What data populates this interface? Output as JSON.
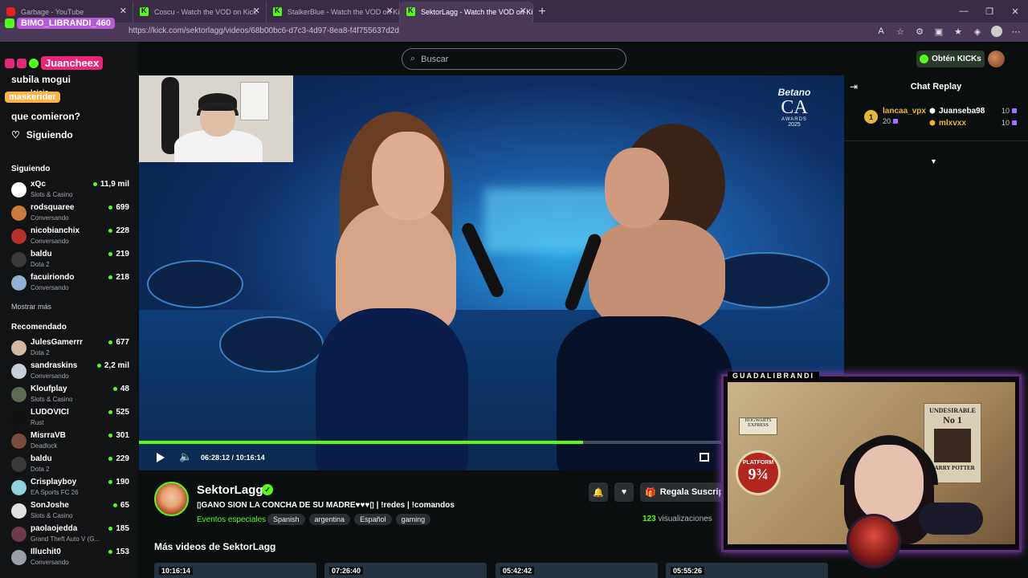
{
  "browser": {
    "tabs": [
      {
        "title": "Garbage - YouTube",
        "icon": "youtube-icon",
        "active": false
      },
      {
        "title": "Coscu - Watch the VOD on Kick",
        "icon": "kick-icon",
        "active": false
      },
      {
        "title": "StalkerBlue - Watch the VOD on Kick",
        "icon": "kick-icon",
        "active": false
      },
      {
        "title": "SektorLagg - Watch the VOD on Kick",
        "icon": "kick-icon",
        "active": true
      }
    ],
    "url": "https://kick.com/sektorlagg/videos/68b00bc6-d7c3-4d97-8ea8-f4f755637d2d"
  },
  "overlay_chat": {
    "user1": "BIMO_LIBRANDI_460",
    "user2": "Juancheex",
    "msg1": "subila mogui",
    "msg2": "lejeje",
    "user3": "maskerider",
    "msg3": "que comieron?"
  },
  "sidebar": {
    "follow_label": "Siguiendo",
    "following_title": "Siguiendo",
    "following": [
      {
        "name": "xQc",
        "category": "Slots & Casino",
        "viewers": "11,9 mil",
        "color": "#ffffff"
      },
      {
        "name": "rodsquaree",
        "category": "Conversando",
        "viewers": "699",
        "color": "#c97b3c"
      },
      {
        "name": "nicobianchix",
        "category": "Conversando",
        "viewers": "228",
        "color": "#b5322a"
      },
      {
        "name": "baldu",
        "category": "Dota 2",
        "viewers": "219",
        "color": "#3a3a3a"
      },
      {
        "name": "facuiriondo",
        "category": "Conversando",
        "viewers": "218",
        "color": "#8fb2d6"
      }
    ],
    "show_more": "Mostrar más",
    "recommended_title": "Recomendado",
    "recommended": [
      {
        "name": "JulesGamerrr",
        "category": "Dota 2",
        "viewers": "677",
        "color": "#d6b7a0"
      },
      {
        "name": "sandraskins",
        "category": "Conversando",
        "viewers": "2,2 mil",
        "color": "#c8cfd6"
      },
      {
        "name": "Kloufplay",
        "category": "Slots & Casino",
        "viewers": "48",
        "color": "#5d6a54"
      },
      {
        "name": "LUDOVICI",
        "category": "Rust",
        "viewers": "525",
        "color": "#101010"
      },
      {
        "name": "MisrraVB",
        "category": "Deadlock",
        "viewers": "301",
        "color": "#7a4b3a"
      },
      {
        "name": "baldu",
        "category": "Dota 2",
        "viewers": "229",
        "color": "#3a3a3a"
      },
      {
        "name": "Crisplayboy",
        "category": "EA Sports FC 26",
        "viewers": "190",
        "color": "#8ed2e0"
      },
      {
        "name": "SonJoshe",
        "category": "Slots & Casino",
        "viewers": "65",
        "color": "#e0e0e0"
      },
      {
        "name": "paolaojedda",
        "category": "Grand Theft Auto V (G...",
        "viewers": "185",
        "color": "#6d3a4a"
      },
      {
        "name": "Illuchit0",
        "category": "Conversando",
        "viewers": "153",
        "color": "#9aa0a6"
      }
    ]
  },
  "header": {
    "search_placeholder": "Buscar",
    "kicks_button": "Obtén KICKs"
  },
  "video": {
    "award_brand": "Betano",
    "award_ca": "CA",
    "award_text": "AWARDS",
    "award_year": "2025",
    "current_time": "06:28:12",
    "duration": "10:16:14",
    "progress": 0.63
  },
  "channel": {
    "name": "SektorLagg",
    "title": "▯GANO SION LA CONCHA DE SU MADRE♥♥♥▯ | !redes | !comandos",
    "category": "Eventos especiales",
    "tags": [
      "Spanish",
      "argentina",
      "Español",
      "gaming"
    ],
    "views_count": "123",
    "views_label": "visualizaciones",
    "gift_label": "Regala Suscrip"
  },
  "more_videos": {
    "title": "Más videos de SektorLagg",
    "durations": [
      "10:16:14",
      "07:26:40",
      "05:42:42",
      "05:55:26"
    ]
  },
  "chat": {
    "title": "Chat Replay",
    "leaderboard": [
      {
        "rank": "1",
        "name": "lancaa_vpx",
        "value": "20",
        "color": "#e8b631"
      },
      {
        "name": "Juanseba98",
        "value": "10",
        "color": "#ffffff"
      },
      {
        "name": "mlxvxx",
        "value": "10",
        "color": "#e8b631"
      }
    ]
  },
  "webcam": {
    "label": "GUADALIBRANDI",
    "platform_text": "PLATFORM",
    "platform_number": "9¾",
    "hogwarts_text": "HOGWARTS EXPRESS",
    "poster_title": "UNDESIRABLE",
    "poster_number": "No 1",
    "poster_name": "HARRY POTTER"
  },
  "colors": {
    "kick_green": "#53fc18",
    "tab_bar": "#3a2c45",
    "page_bg": "#0b0e0f"
  }
}
